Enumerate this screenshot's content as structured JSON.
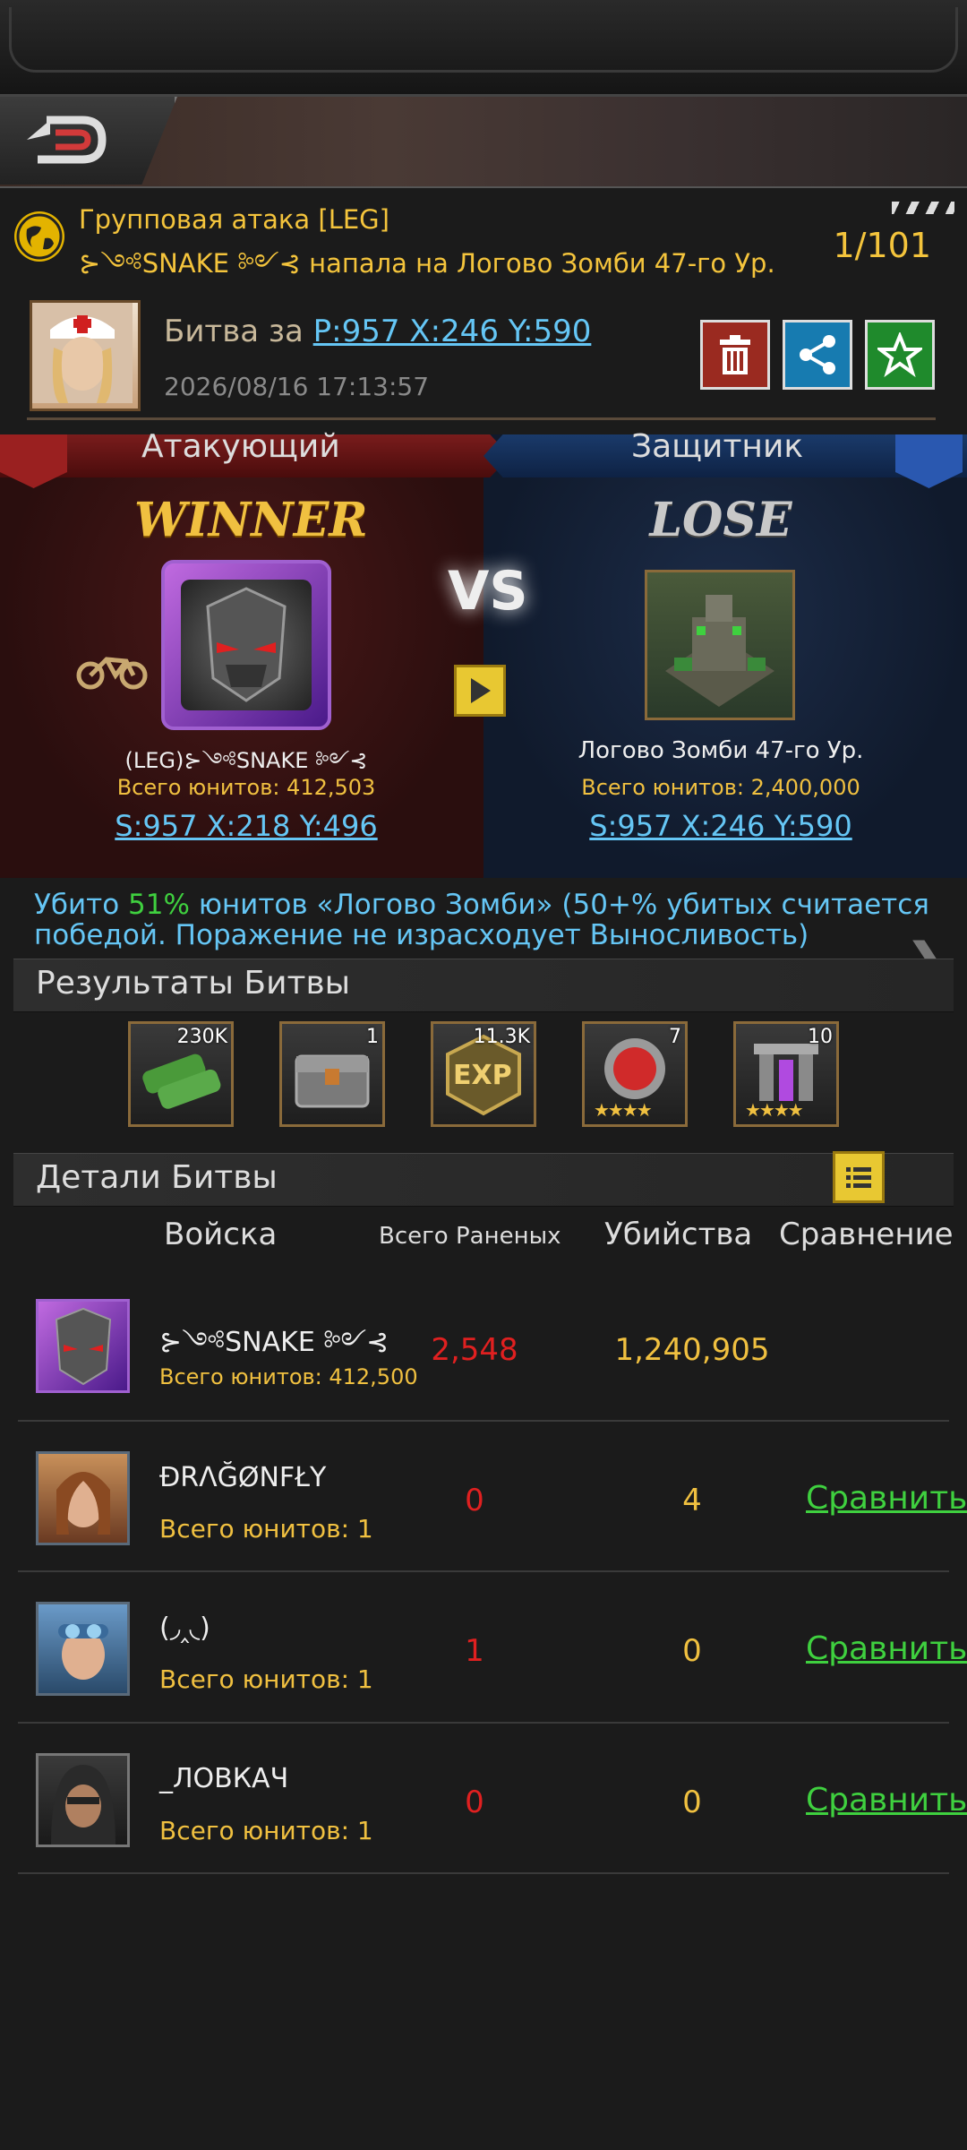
{
  "notification": {
    "line1": "Групповая атака [LEG]",
    "line2_prefix": "⊱༺SNAKE ༻⊰",
    "line2_text": "напала на Логово Зомби 47-го Ур.",
    "count": "1/101"
  },
  "battle": {
    "title_prefix": "Битва за",
    "title_coord": "P:957 X:246 Y:590",
    "timestamp": "2026/08/16 17:13:57"
  },
  "attacker": {
    "tab_label": "Атакующий",
    "result": "WINNER",
    "name": "(LEG)⊱༺SNAKE ༻⊰",
    "units": "Всего юнитов: 412,503",
    "coord": "S:957 X:218 Y:496"
  },
  "defender": {
    "tab_label": "Защитник",
    "result": "LOSE",
    "name": "Логово Зомби 47-го Ур.",
    "units": "Всего юнитов: 2,400,000",
    "coord": "S:957 X:246 Y:590"
  },
  "vs_label": "VS",
  "kill_info": {
    "prefix": "Убито",
    "percent": "51%",
    "rest_line1": "юнитов «Логово Зомби» (50+% убитых считается",
    "line2": "победой. Поражение не израсходует Выносливость)"
  },
  "results_section": {
    "title": "Результаты Битвы",
    "rewards": [
      {
        "icon": "battery-icon",
        "count": "230K"
      },
      {
        "icon": "chest-icon",
        "count": "1"
      },
      {
        "icon": "exp-icon",
        "count": "11.3K",
        "label": "EXP"
      },
      {
        "icon": "red-gem-icon",
        "count": "7",
        "stars": "★★★★"
      },
      {
        "icon": "purple-tower-icon",
        "count": "10",
        "stars": "★★★★"
      }
    ]
  },
  "details_section": {
    "title": "Детали Битвы",
    "columns": [
      "Войска",
      "Всего Раненых",
      "Убийства",
      "Сравнение"
    ],
    "rows": [
      {
        "name": "⊱༺SNAKE ༻⊰",
        "units": "Всего юнитов: 412,500",
        "wounded": "2,548",
        "kills": "1,240,905",
        "compare": ""
      },
      {
        "name": "ĐRΛĞØNFŁY",
        "units": "Всего юнитов: 1",
        "wounded": "0",
        "kills": "4",
        "compare": "Сравнить"
      },
      {
        "name": "(◞‸◟)",
        "units": "Всего юнитов: 1",
        "wounded": "1",
        "kills": "0",
        "compare": "Сравнить"
      },
      {
        "name": "_ЛОВКАЧ",
        "units": "Всего юнитов: 1",
        "wounded": "0",
        "kills": "0",
        "compare": "Сравнить"
      }
    ]
  },
  "colors": {
    "gold": "#f4c43c",
    "link": "#65c6f5",
    "green": "#3fd03f",
    "red": "#e02020"
  }
}
